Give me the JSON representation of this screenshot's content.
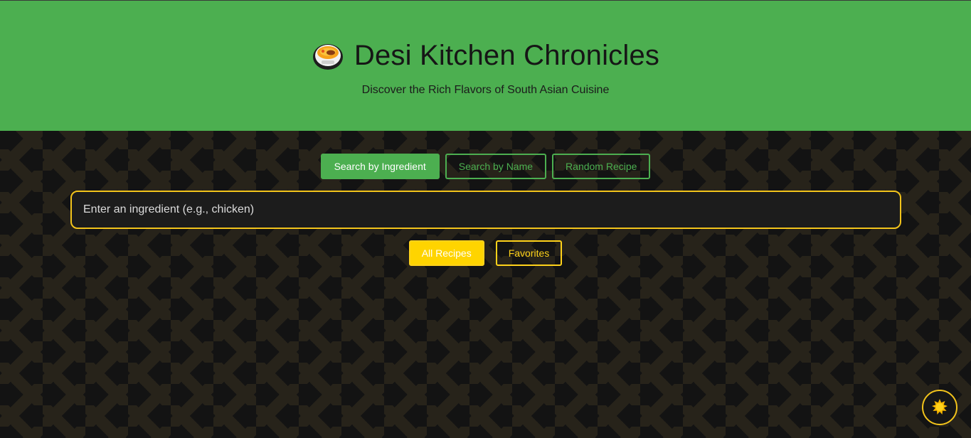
{
  "header": {
    "logo_icon": "curry-bowl-icon",
    "title": "Desi Kitchen Chronicles",
    "subtitle": "Discover the Rich Flavors of South Asian Cuisine"
  },
  "search_tabs": [
    {
      "label": "Search by Ingredient",
      "active": true
    },
    {
      "label": "Search by Name",
      "active": false
    },
    {
      "label": "Random Recipe",
      "active": false
    }
  ],
  "search": {
    "placeholder": "Enter an ingredient (e.g., chicken)",
    "value": ""
  },
  "filters": [
    {
      "label": "All Recipes",
      "active": true
    },
    {
      "label": "Favorites",
      "active": false
    }
  ],
  "theme_toggle": {
    "icon": "sun-icon"
  },
  "colors": {
    "header_bg": "#4caf50",
    "accent_green": "#4caf50",
    "accent_yellow": "#ffd400",
    "page_bg": "#131313"
  }
}
